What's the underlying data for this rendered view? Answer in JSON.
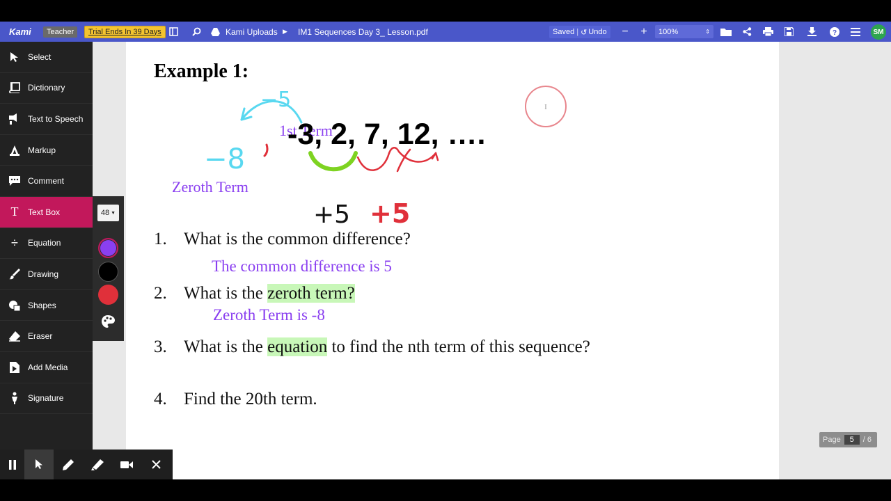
{
  "topbar": {
    "brand": "Kami",
    "teacher": "Teacher",
    "trial": "Trial Ends In 39 Days",
    "breadcrumb": {
      "folder": "Kami Uploads",
      "file": "IM1 Sequences Day 3_ Lesson.pdf"
    },
    "saved": "Saved",
    "undo": "Undo",
    "zoom": "100%",
    "avatar": "SM"
  },
  "sidebar": {
    "items": [
      {
        "label": "Select",
        "icon": "cursor-icon"
      },
      {
        "label": "Dictionary",
        "icon": "book-icon"
      },
      {
        "label": "Text to Speech",
        "icon": "speaker-icon"
      },
      {
        "label": "Markup",
        "icon": "markup-icon"
      },
      {
        "label": "Comment",
        "icon": "comment-icon"
      },
      {
        "label": "Text Box",
        "icon": "text-box-icon"
      },
      {
        "label": "Equation",
        "icon": "divide-icon"
      },
      {
        "label": "Drawing",
        "icon": "brush-icon"
      },
      {
        "label": "Shapes",
        "icon": "shapes-icon"
      },
      {
        "label": "Eraser",
        "icon": "eraser-icon"
      },
      {
        "label": "Add Media",
        "icon": "media-icon"
      },
      {
        "label": "Signature",
        "icon": "pen-nib-icon"
      }
    ],
    "active": "Text Box"
  },
  "textbox_options": {
    "font_size": "48",
    "colors": [
      "#8a3ff0",
      "#000000",
      "#e0303a"
    ]
  },
  "document": {
    "title": "Example 1:",
    "sequence": "-3, 2, 7, 12, ….",
    "annotations": {
      "first_term": "1st Term",
      "zeroth_term": "Zeroth Term",
      "minus_five": "−5",
      "minus_eight": "−8",
      "plus_five_black": "+5",
      "plus_five_red": "+5"
    },
    "questions": [
      {
        "num": "1.",
        "text_before": "What is the common difference?",
        "highlight": "",
        "text_after": ""
      },
      {
        "num": "2.",
        "text_before": "What is the ",
        "highlight": "zeroth term?",
        "text_after": ""
      },
      {
        "num": "3.",
        "text_before": "What is the ",
        "highlight": "equation",
        "text_after": " to find the nth term of this sequence?"
      },
      {
        "num": "4.",
        "text_before": "Find the 20th term.",
        "highlight": "",
        "text_after": ""
      }
    ],
    "answers": {
      "q1": "The common difference is 5",
      "q2": "Zeroth Term is -8"
    }
  },
  "pager": {
    "label": "Page",
    "current": "5",
    "total": "/ 6"
  }
}
